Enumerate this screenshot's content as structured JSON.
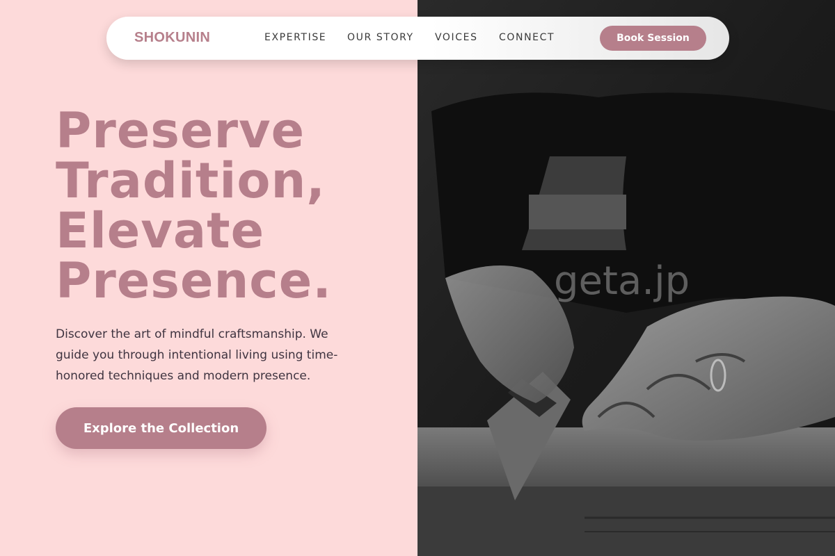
{
  "nav": {
    "brand": "SHOKUNIN",
    "links": [
      "EXPERTISE",
      "OUR STORY",
      "VOICES",
      "CONNECT"
    ],
    "cta_label": "Book Session"
  },
  "hero": {
    "title_lines": [
      "Preserve",
      "Tradition,",
      "Elevate",
      "Presence."
    ],
    "description": "Discover the art of mindful craftsmanship. We guide you through intentional living using time-honored techniques and modern presence.",
    "cta_label": "Explore the Collection"
  },
  "image": {
    "watermark": "geta.jp",
    "subject": "craftsman-hands-sawing-wood-icon"
  },
  "colors": {
    "background": "#fddada",
    "accent": "#b67f8b",
    "text_dark": "#3f3440",
    "photo_dark": "#1e1e1e"
  }
}
